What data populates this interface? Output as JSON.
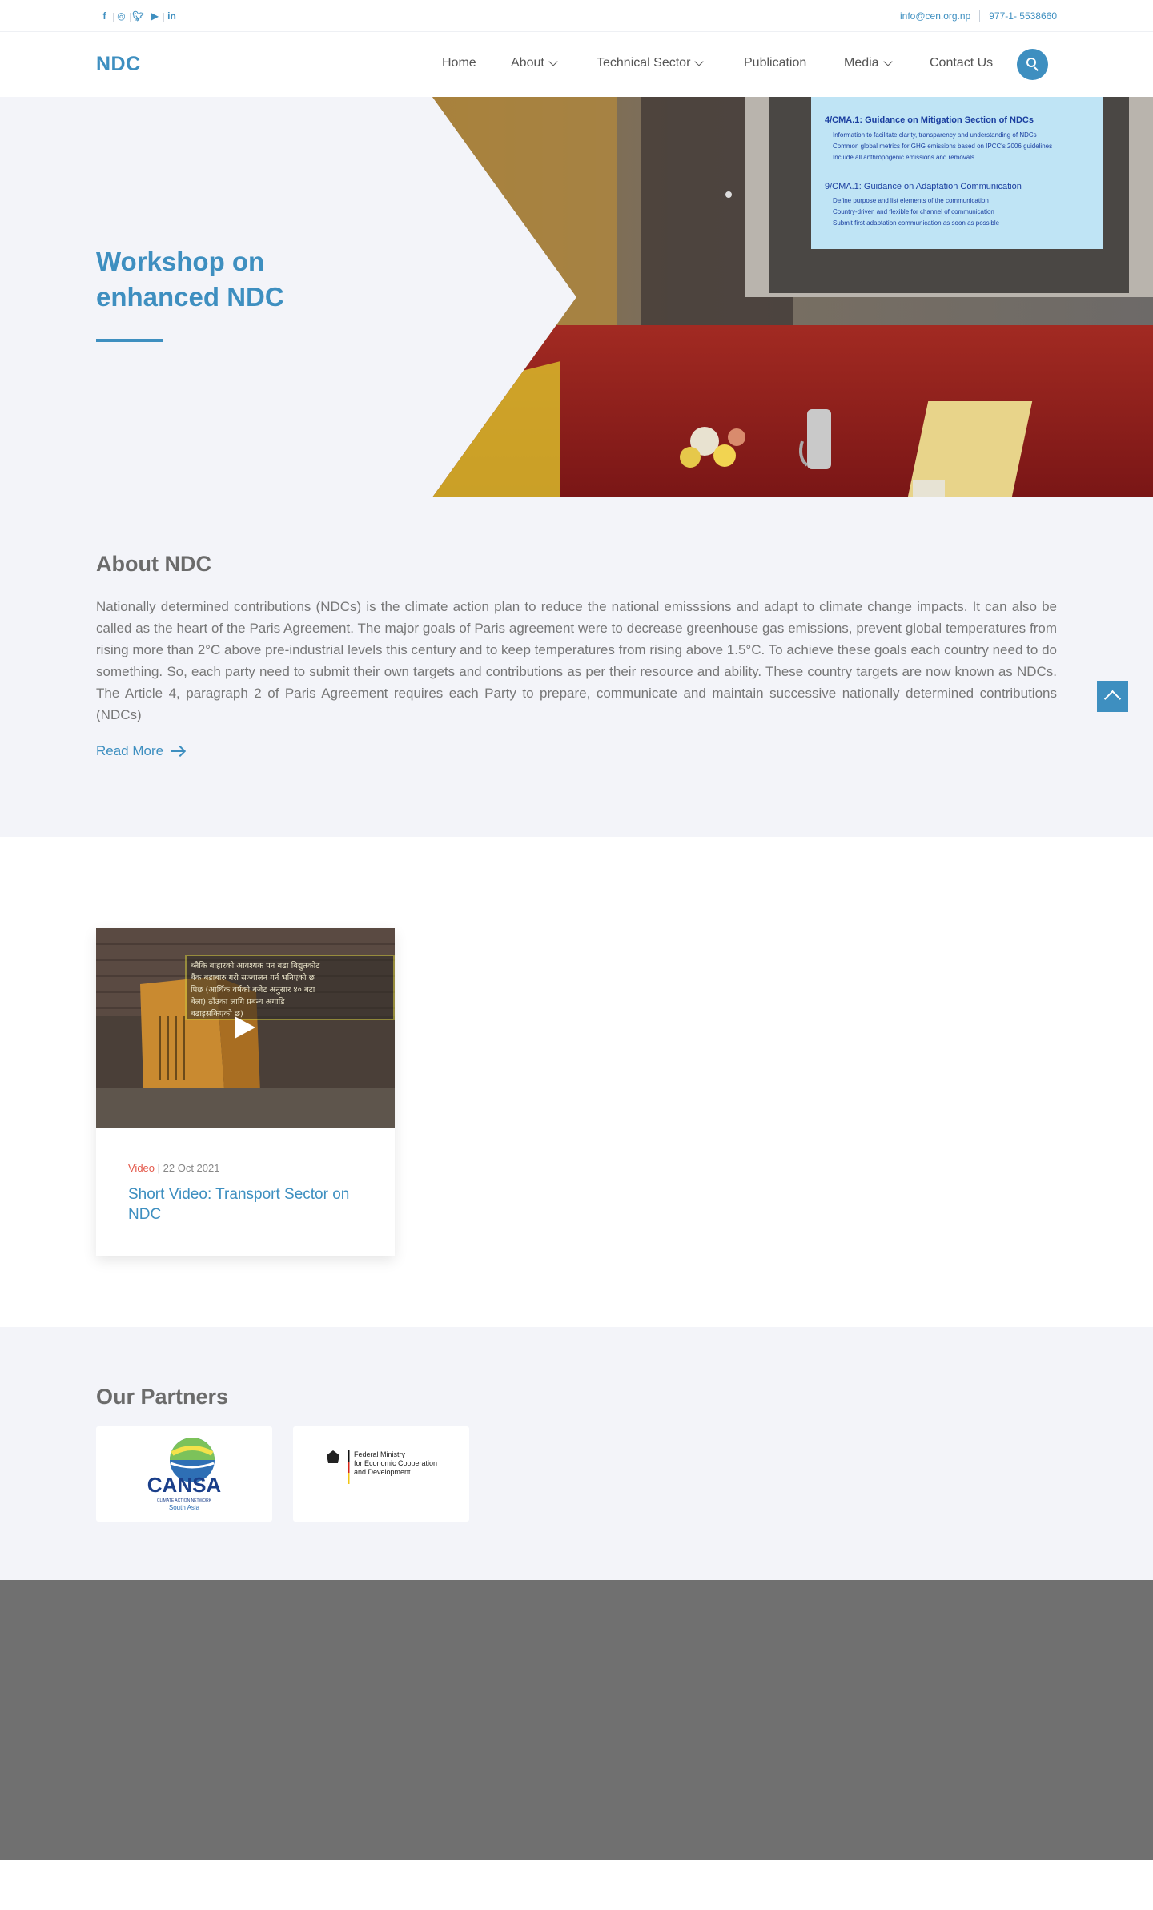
{
  "topbar": {
    "social": [
      {
        "icon": "facebook-icon",
        "glyph": "f"
      },
      {
        "icon": "instagram-icon",
        "glyph": "◎"
      },
      {
        "icon": "twitter-icon",
        "glyph": "🐦︎"
      },
      {
        "icon": "youtube-icon",
        "glyph": "▶"
      },
      {
        "icon": "linkedin-icon",
        "glyph": "in"
      }
    ],
    "email": "info@cen.org.np",
    "phone": "977-1- 5538660"
  },
  "nav": {
    "logo": "NDC",
    "items": [
      "Home",
      "About",
      "Technical Sector",
      "Publication",
      "Media",
      "Contact Us"
    ]
  },
  "hero": {
    "title": "Workshop on enhanced NDC",
    "slide": {
      "heading": "4/CMA.1: Guidance on Mitigation Section of NDCs",
      "b1": "Information to facilitate clarity, transparency and understanding of NDCs",
      "b2": "Common global metrics for GHG emissions based on IPCC's 2006 guidelines",
      "b3": "Include all anthropogenic emissions and removals",
      "heading2": "9/CMA.1: Guidance on Adaptation Communication",
      "b4": "Define purpose and list elements of the communication",
      "b5": "Country-driven and flexible for channel of communication",
      "b6": "Submit first adaptation communication as soon as possible"
    }
  },
  "about": {
    "title": "About NDC",
    "body": "Nationally determined contributions (NDCs) is the climate action plan to reduce the national emisssions and adapt to climate change impacts.  It can also be called as the  heart of the Paris Agreement. The major goals of Paris agreement were to decrease greenhouse gas emissions, prevent global temperatures from rising more than 2°C above pre-industrial levels this century and to keep temperatures from rising above 1.5°C. To achieve these goals each country need to do something. So, each  party need to submit their own targets and contributions as per their resource and ability. These country targets are now known as NDCs. The Article 4, paragraph 2 of Paris Agreement requires each Party to prepare, communicate and maintain successive nationally determined contributions (NDCs)",
    "read_more": "Read More"
  },
  "video": {
    "category": "Video",
    "date": "| 22 Oct 2021",
    "title": "Short Video: Transport Sector on NDC",
    "overlay_lines": [
      "ब्लैकि बाहारको आवश्यक पन बढा बिद्युतकोट",
      "बैंक बडाबारु गरी सञ्चालन गर्न भनिएको छ",
      "पिछ (आर्थिक वर्षको बजेट अनुसार ४० बटा",
      "बेला) ठाँउका लागि प्रबन्ध अगाडि",
      "बढाइसकिएको छ)"
    ]
  },
  "partners": {
    "title": "Our Partners",
    "cansa": {
      "name": "CANSA",
      "tagline": "CLIMATE ACTION NETWORK",
      "region": "South Asia"
    },
    "bmz": {
      "line1": "Federal Ministry",
      "line2": "for Economic Cooperation",
      "line3": "and Development"
    }
  },
  "colors": {
    "accent": "#3e8fc0",
    "background": "#f3f4f9",
    "footer": "#707070",
    "meta_category": "#e4584a"
  }
}
